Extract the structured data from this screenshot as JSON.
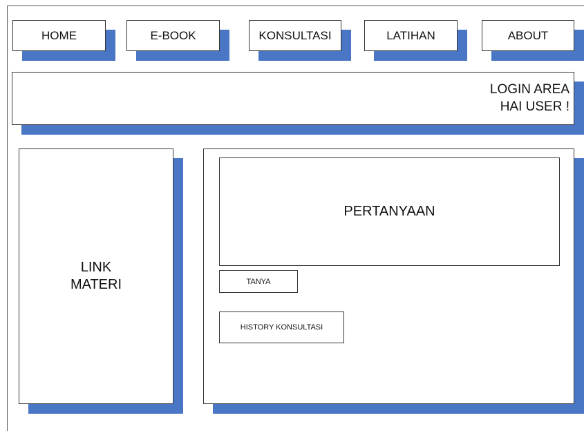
{
  "nav": {
    "home": "HOME",
    "ebook": "E-BOOK",
    "konsultasi": "KONSULTASI",
    "latihan": "LATIHAN",
    "about": "ABOUT"
  },
  "login": {
    "line1": "LOGIN AREA",
    "line2": "HAI USER !"
  },
  "sidebar": {
    "line1": "LINK",
    "line2": "MATERI"
  },
  "main": {
    "question_label": "PERTANYAAN",
    "tanya_button": "TANYA",
    "history_button": "HISTORY KONSULTASI"
  },
  "colors": {
    "shadow": "#4a76c6",
    "border": "#333333",
    "background": "#ffffff"
  }
}
